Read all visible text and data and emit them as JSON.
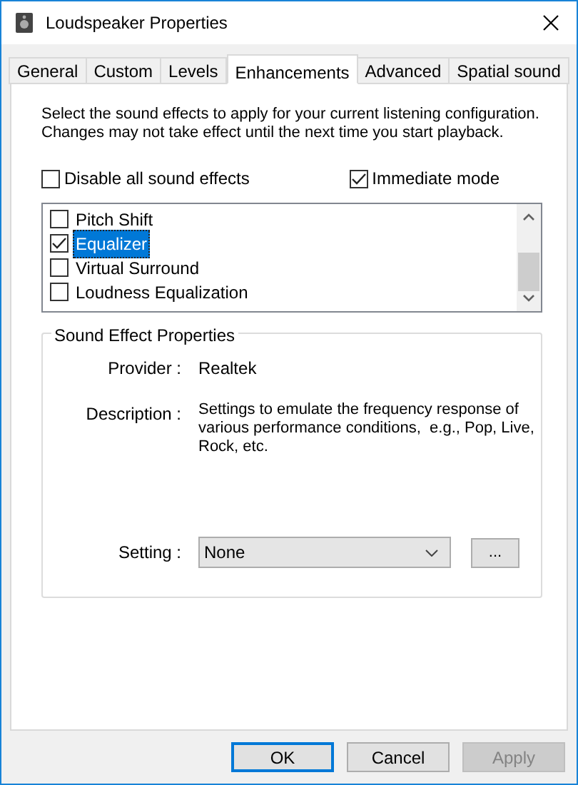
{
  "window": {
    "title": "Loudspeaker Properties"
  },
  "tabs": [
    {
      "label": "General",
      "selected": false
    },
    {
      "label": "Custom",
      "selected": false
    },
    {
      "label": "Levels",
      "selected": false
    },
    {
      "label": "Enhancements",
      "selected": true
    },
    {
      "label": "Advanced",
      "selected": false
    },
    {
      "label": "Spatial sound",
      "selected": false
    }
  ],
  "intro": "Select the sound effects to apply for your current listening configuration. Changes may not take effect until the next time you start playback.",
  "options": [
    {
      "label": "Disable all sound effects",
      "checked": false
    },
    {
      "label": "Immediate mode",
      "checked": true
    }
  ],
  "effects": [
    {
      "label": "Pitch Shift",
      "checked": false,
      "selected": false
    },
    {
      "label": "Equalizer",
      "checked": true,
      "selected": true
    },
    {
      "label": "Virtual Surround",
      "checked": false,
      "selected": false
    },
    {
      "label": "Loudness Equalization",
      "checked": false,
      "selected": false
    }
  ],
  "properties": {
    "title": "Sound Effect Properties",
    "provider_label": "Provider :",
    "provider": "Realtek",
    "description_label": "Description :",
    "description": "Settings to emulate the frequency response of various performance conditions,  e.g., Pop, Live, Rock, etc.",
    "setting_label": "Setting :",
    "setting": "None",
    "more_button": "..."
  },
  "buttons": [
    {
      "label": "OK",
      "default": true,
      "disabled": false
    },
    {
      "label": "Cancel",
      "default": false,
      "disabled": false
    },
    {
      "label": "Apply",
      "default": false,
      "disabled": true
    }
  ]
}
